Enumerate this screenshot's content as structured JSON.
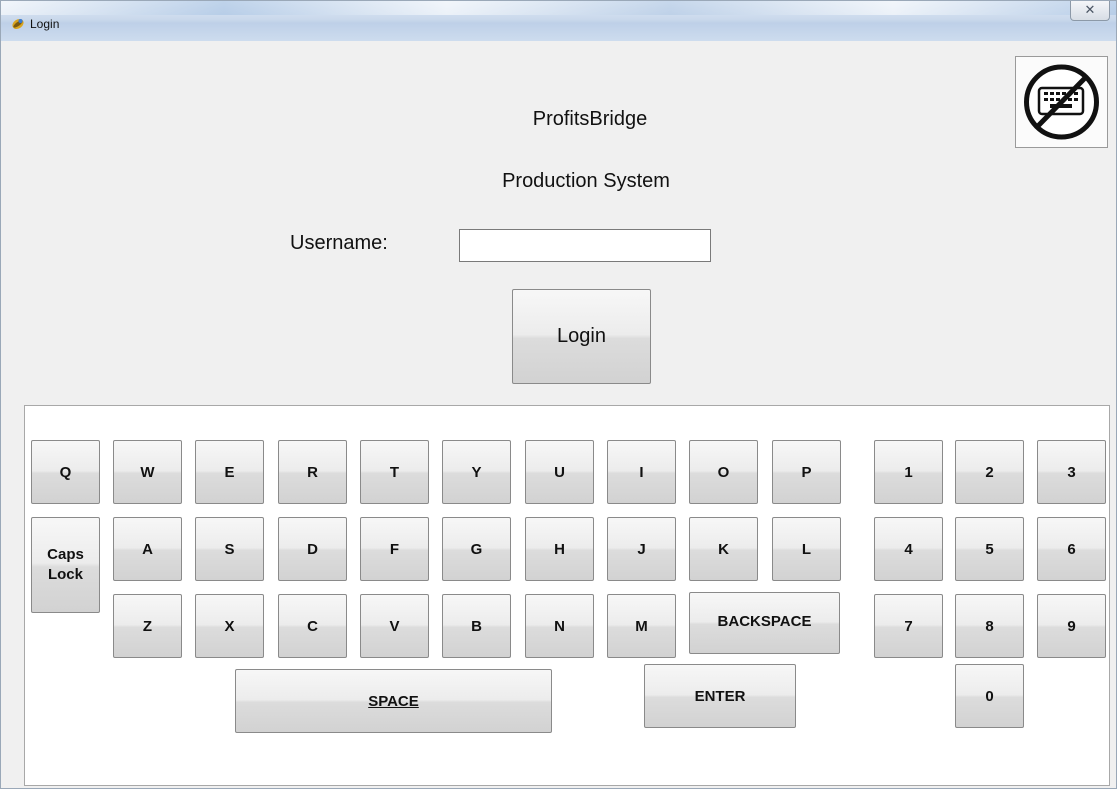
{
  "window": {
    "title": "Login",
    "close_glyph": "✕"
  },
  "header": {
    "app_name": "ProfitsBridge",
    "system_name": "Production System"
  },
  "form": {
    "username_label": "Username:",
    "username_value": "",
    "login_label": "Login"
  },
  "keyboard_toggle": {
    "icon": "keyboard-disabled-icon"
  },
  "keyboard": {
    "row1": [
      "Q",
      "W",
      "E",
      "R",
      "T",
      "Y",
      "U",
      "I",
      "O",
      "P"
    ],
    "row2": [
      "A",
      "S",
      "D",
      "F",
      "G",
      "H",
      "J",
      "K",
      "L"
    ],
    "row3": [
      "Z",
      "X",
      "C",
      "V",
      "B",
      "N",
      "M"
    ],
    "caps": [
      "Caps",
      "Lock"
    ],
    "backspace": "BACKSPACE",
    "space": "SPACE",
    "enter": "ENTER",
    "numpad": [
      "1",
      "2",
      "3",
      "4",
      "5",
      "6",
      "7",
      "8",
      "9",
      "0"
    ]
  }
}
